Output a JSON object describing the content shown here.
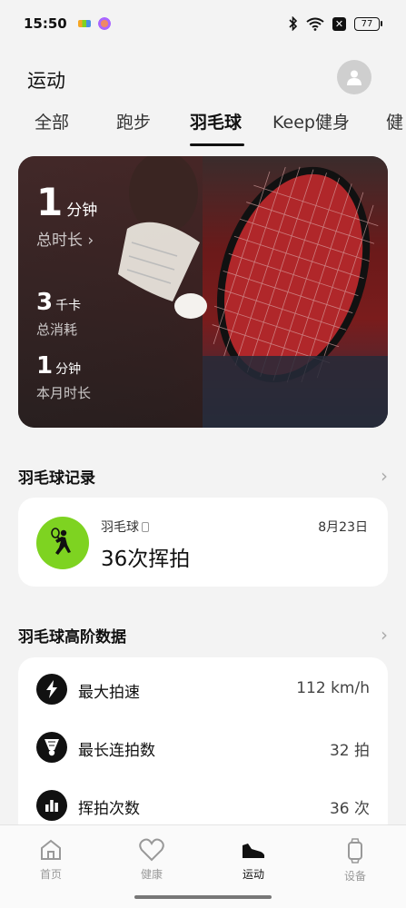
{
  "status_bar": {
    "time": "15:50",
    "battery": "77",
    "x_glyph": "✕"
  },
  "header": {
    "title": "运动"
  },
  "tabs": [
    {
      "label": "全部"
    },
    {
      "label": "跑步"
    },
    {
      "label": "羽毛球"
    },
    {
      "label": "Keep健身"
    },
    {
      "label": "健"
    }
  ],
  "active_tab": "羽毛球",
  "hero": {
    "total_time_value": "1",
    "total_time_unit": "分钟",
    "total_time_label": "总时长",
    "total_time_chevron": "›",
    "calories_value": "3",
    "calories_unit": "千卡",
    "calories_label": "总消耗",
    "month_time_value": "1",
    "month_time_unit": "分钟",
    "month_time_label": "本月时长"
  },
  "records": {
    "section_title": "羽毛球记录",
    "chevron": "›",
    "item": {
      "sport": "羽毛球",
      "date": "8月23日",
      "value": "36次挥拍"
    }
  },
  "advanced": {
    "section_title": "羽毛球高阶数据",
    "chevron": "›",
    "rows": [
      {
        "label": "最大拍速",
        "value": "112 km/h",
        "icon": "lightning-icon"
      },
      {
        "label": "最长连拍数",
        "value": "32 拍",
        "icon": "shuttlecock-icon"
      },
      {
        "label": "挥拍次数",
        "value": "36 次",
        "icon": "bar-chart-icon"
      }
    ]
  },
  "bottom_nav": [
    {
      "label": "首页",
      "icon": "home-icon"
    },
    {
      "label": "健康",
      "icon": "heart-icon"
    },
    {
      "label": "运动",
      "icon": "shoe-icon",
      "active": true
    },
    {
      "label": "设备",
      "icon": "watch-icon"
    }
  ],
  "colors": {
    "accent_green": "#7ed321",
    "background": "#f3f3f3",
    "card": "#ffffff"
  }
}
